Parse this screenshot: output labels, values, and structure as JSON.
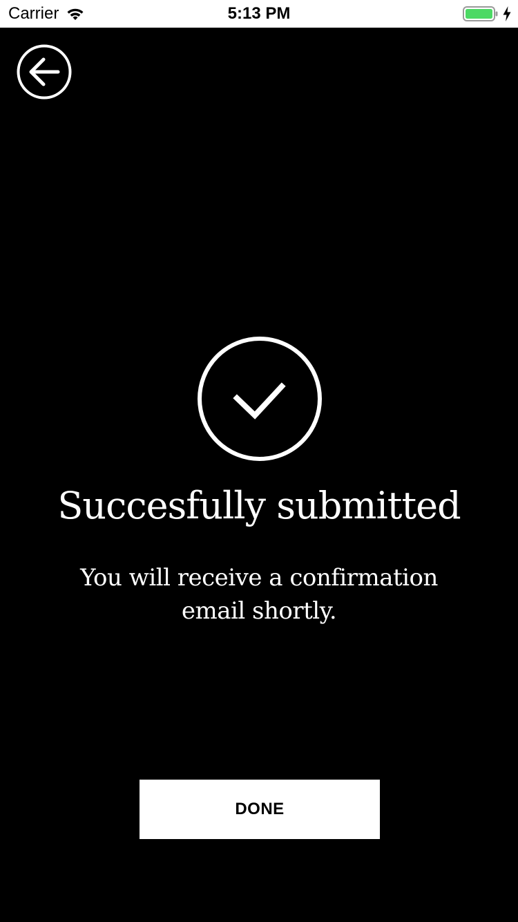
{
  "status_bar": {
    "carrier": "Carrier",
    "time": "5:13 PM",
    "wifi_icon": "wifi-icon",
    "battery_icon": "battery-icon",
    "charging_icon": "bolt-icon",
    "battery_color": "#4cd964"
  },
  "nav": {
    "back_icon": "back-arrow-circle-icon"
  },
  "success": {
    "icon": "check-circle-icon",
    "title": "Succesfully submitted",
    "message": "You will receive a confirmation email shortly."
  },
  "actions": {
    "done_label": "DONE"
  },
  "colors": {
    "background": "#000000",
    "foreground": "#ffffff",
    "button_background": "#ffffff",
    "button_text": "#000000"
  }
}
